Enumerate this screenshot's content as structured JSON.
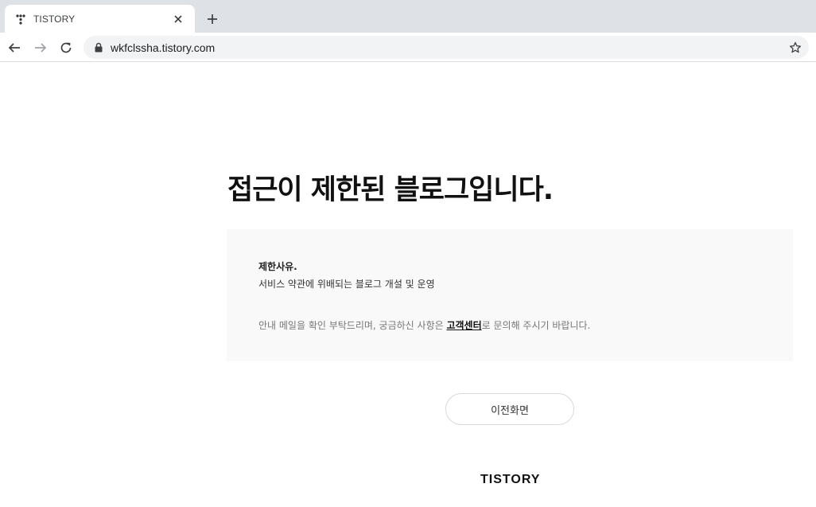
{
  "browser": {
    "tab": {
      "title": "TISTORY",
      "favicon": "tistory-dots-icon"
    },
    "new_tab_icon": "plus-icon",
    "url": "wkfclssha.tistory.com"
  },
  "page": {
    "heading": "접근이 제한된 블로그입니다.",
    "reason_label": "제한사유.",
    "reason_text": "서비스 약관에 위배되는 블로그 개설 및 운영",
    "notice_before": "안내 메일을 확인 부탁드리며, 궁금하신 사항은 ",
    "notice_link": "고객센터",
    "notice_after": "로 문의해 주시기 바랍니다.",
    "back_button": "이전화면",
    "footer_logo": "TISTORY"
  },
  "colors": {
    "tabstrip": "#dee1e6",
    "omnibox": "#f1f3f4",
    "reason_box": "#f9f9f9"
  }
}
